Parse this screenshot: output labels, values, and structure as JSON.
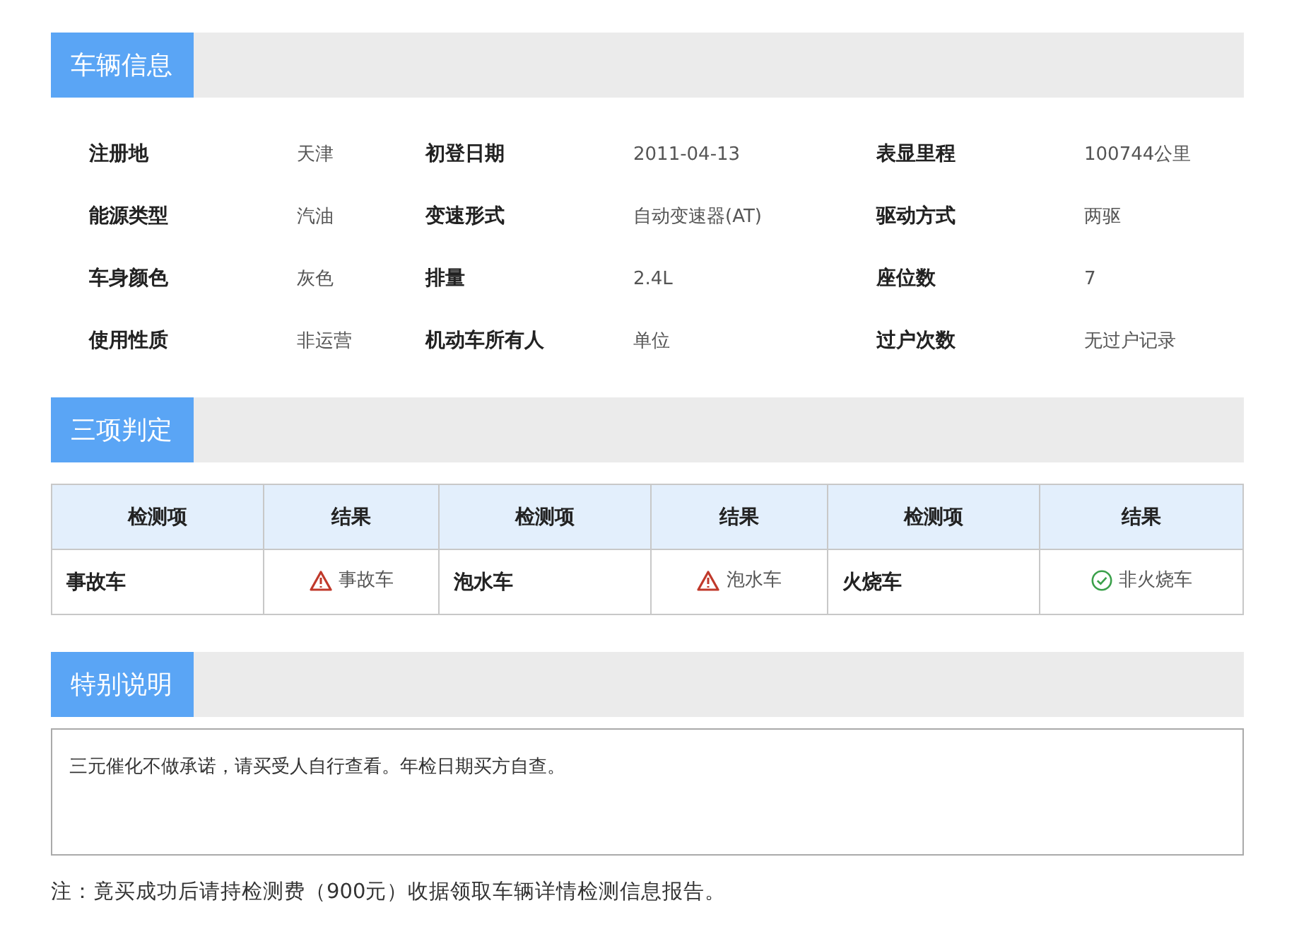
{
  "vehicle_info": {
    "title": "车辆信息",
    "rows": [
      [
        {
          "label": "注册地",
          "value": "天津"
        },
        {
          "label": "初登日期",
          "value": "2011-04-13"
        },
        {
          "label": "表显里程",
          "value": "100744公里"
        }
      ],
      [
        {
          "label": "能源类型",
          "value": "汽油"
        },
        {
          "label": "变速形式",
          "value": "自动变速器(AT)"
        },
        {
          "label": "驱动方式",
          "value": "两驱"
        }
      ],
      [
        {
          "label": "车身颜色",
          "value": "灰色"
        },
        {
          "label": "排量",
          "value": "2.4L"
        },
        {
          "label": "座位数",
          "value": "7"
        }
      ],
      [
        {
          "label": "使用性质",
          "value": "非运营"
        },
        {
          "label": "机动车所有人",
          "value": "单位"
        },
        {
          "label": "过户次数",
          "value": "无过户记录"
        }
      ]
    ]
  },
  "three_checks": {
    "title": "三项判定",
    "columns": [
      "检测项",
      "结果",
      "检测项",
      "结果",
      "检测项",
      "结果"
    ],
    "items": [
      {
        "item": "事故车",
        "result": "事故车",
        "kind": "warning"
      },
      {
        "item": "泡水车",
        "result": "泡水车",
        "kind": "warning"
      },
      {
        "item": "火烧车",
        "result": "非火烧车",
        "kind": "ok"
      }
    ]
  },
  "special_note": {
    "title": "特别说明",
    "text": "三元催化不做承诺，请买受人自行查看。年检日期买方自查。"
  },
  "footer_note": "注：竟买成功后请持检测费（900元）收据领取车辆详情检测信息报告。"
}
